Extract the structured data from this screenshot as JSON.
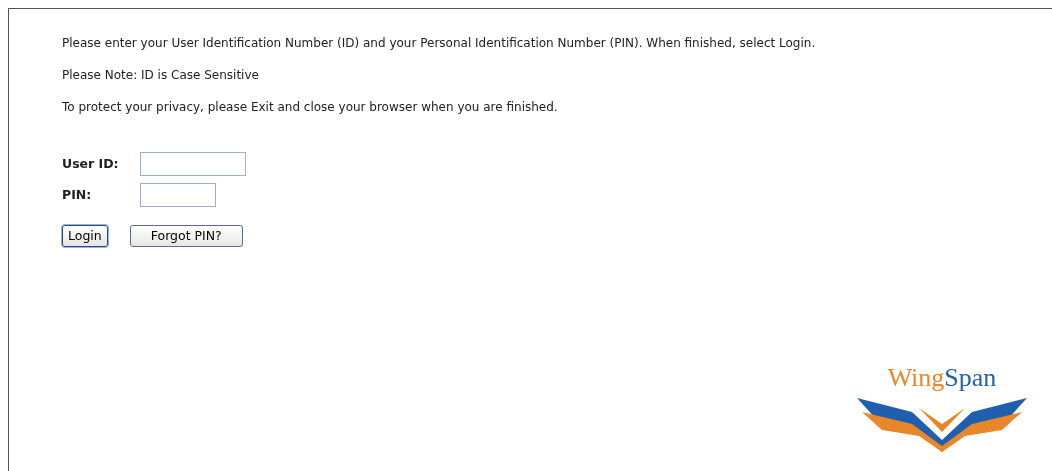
{
  "instructions": [
    "Please enter your User Identification Number (ID) and your Personal Identification Number (PIN). When finished, select Login.",
    "Please Note: ID is Case Sensitive",
    "To protect your privacy, please Exit and close your browser when you are finished."
  ],
  "fields": [
    {
      "label": "User ID:",
      "kind": "wide"
    },
    {
      "label": "PIN:",
      "kind": "narrow"
    }
  ],
  "buttons": [
    {
      "label": "Login",
      "focused": true
    },
    {
      "label": "Forgot PIN?",
      "focused": false
    }
  ],
  "logo": {
    "parts": [
      {
        "text": "Wing",
        "color": "#e8862a"
      },
      {
        "text": "Span",
        "color": "#1f5fae"
      }
    ]
  }
}
